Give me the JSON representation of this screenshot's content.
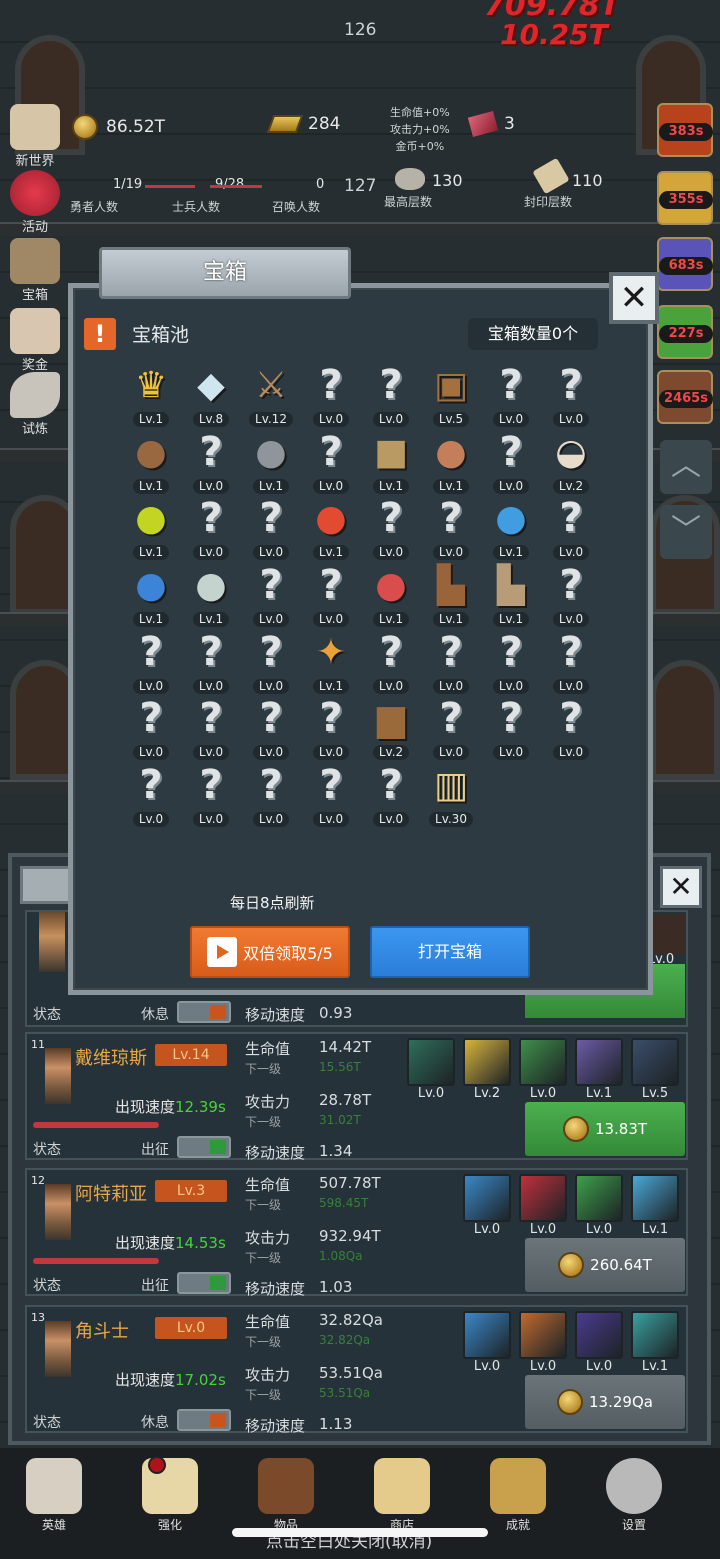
{
  "header": {
    "floor_counter": "126",
    "damage_big": "709.78T",
    "damage_small": "10.25T"
  },
  "resources": {
    "coins": "86.52T",
    "gold_bars": "284",
    "bonus_hp": "生命值+0%",
    "bonus_atk": "攻击力+0%",
    "bonus_gold": "金币+0%",
    "gems": "3"
  },
  "counters": {
    "heroes": "1/19",
    "heroes_label": "勇者人数",
    "soldiers": "9/28",
    "soldiers_label": "士兵人数",
    "summons": "0",
    "summons_label": "召唤人数",
    "current_floor": "127",
    "max_floor": "130",
    "max_floor_label": "最高层数",
    "seal_floor": "110",
    "seal_floor_label": "封印层数"
  },
  "side_menu": [
    {
      "label": "新世界"
    },
    {
      "label": "活动"
    },
    {
      "label": "宝箱"
    },
    {
      "label": "奖金"
    },
    {
      "label": "试炼"
    }
  ],
  "right_timers": [
    "383s",
    "355s",
    "683s",
    "227s",
    "2465s"
  ],
  "dialog": {
    "title": "宝箱",
    "pool_label": "宝箱池",
    "chest_count": "宝箱数量0个",
    "refresh_note": "每日8点刷新",
    "double_button": "双倍领取5/5",
    "open_button": "打开宝箱",
    "items": [
      {
        "icon": "crown-icon",
        "glyph": "♛",
        "color": "#f0c23a",
        "lv": "Lv.1"
      },
      {
        "icon": "diamond-icon",
        "glyph": "◆",
        "color": "#cfe6f0",
        "lv": "Lv.8"
      },
      {
        "icon": "sword-icon",
        "glyph": "⚔",
        "color": "#b98c5c",
        "lv": "Lv.12"
      },
      {
        "icon": "unknown-icon",
        "glyph": "?",
        "color": "",
        "lv": "Lv.0"
      },
      {
        "icon": "unknown-icon",
        "glyph": "?",
        "color": "",
        "lv": "Lv.0"
      },
      {
        "icon": "armor-icon",
        "glyph": "▣",
        "color": "#a4703e",
        "lv": "Lv.5"
      },
      {
        "icon": "unknown-icon",
        "glyph": "?",
        "color": "",
        "lv": "Lv.0"
      },
      {
        "icon": "unknown-icon",
        "glyph": "?",
        "color": "",
        "lv": "Lv.0"
      },
      {
        "icon": "leather-helmet-icon",
        "glyph": "●",
        "color": "#9a6840",
        "lv": "Lv.1"
      },
      {
        "icon": "unknown-icon",
        "glyph": "?",
        "color": "",
        "lv": "Lv.0"
      },
      {
        "icon": "iron-helmet-icon",
        "glyph": "●",
        "color": "#8f959a",
        "lv": "Lv.1"
      },
      {
        "icon": "unknown-icon",
        "glyph": "?",
        "color": "",
        "lv": "Lv.0"
      },
      {
        "icon": "gold-helmet-icon",
        "glyph": "■",
        "color": "#b99a63",
        "lv": "Lv.1"
      },
      {
        "icon": "meat-icon",
        "glyph": "●",
        "color": "#c47f5a",
        "lv": "Lv.1"
      },
      {
        "icon": "unknown-icon",
        "glyph": "?",
        "color": "",
        "lv": "Lv.0"
      },
      {
        "icon": "rice-bowl-icon",
        "glyph": "◒",
        "color": "#e7dccc",
        "lv": "Lv.2"
      },
      {
        "icon": "yellow-potion-icon",
        "glyph": "●",
        "color": "#c4d423",
        "lv": "Lv.1"
      },
      {
        "icon": "unknown-icon",
        "glyph": "?",
        "color": "",
        "lv": "Lv.0"
      },
      {
        "icon": "unknown-icon",
        "glyph": "?",
        "color": "",
        "lv": "Lv.0"
      },
      {
        "icon": "red-potion-icon",
        "glyph": "●",
        "color": "#e14b32",
        "lv": "Lv.1"
      },
      {
        "icon": "unknown-icon",
        "glyph": "?",
        "color": "",
        "lv": "Lv.0"
      },
      {
        "icon": "unknown-icon",
        "glyph": "?",
        "color": "",
        "lv": "Lv.0"
      },
      {
        "icon": "blue-potion-icon",
        "glyph": "●",
        "color": "#3f9de0",
        "lv": "Lv.1"
      },
      {
        "icon": "unknown-icon",
        "glyph": "?",
        "color": "",
        "lv": "Lv.0"
      },
      {
        "icon": "big-blue-potion-icon",
        "glyph": "●",
        "color": "#3b84d8",
        "lv": "Lv.1"
      },
      {
        "icon": "white-bottle-icon",
        "glyph": "●",
        "color": "#c5d3cf",
        "lv": "Lv.1"
      },
      {
        "icon": "unknown-icon",
        "glyph": "?",
        "color": "",
        "lv": "Lv.0"
      },
      {
        "icon": "unknown-icon",
        "glyph": "?",
        "color": "",
        "lv": "Lv.0"
      },
      {
        "icon": "red-bottle-icon",
        "glyph": "●",
        "color": "#d94d4d",
        "lv": "Lv.1"
      },
      {
        "icon": "leather-boots-icon",
        "glyph": "▙",
        "color": "#9a643a",
        "lv": "Lv.1"
      },
      {
        "icon": "cloth-boots-icon",
        "glyph": "▙",
        "color": "#b89c77",
        "lv": "Lv.1"
      },
      {
        "icon": "unknown-icon",
        "glyph": "?",
        "color": "",
        "lv": "Lv.0"
      },
      {
        "icon": "unknown-icon",
        "glyph": "?",
        "color": "",
        "lv": "Lv.0"
      },
      {
        "icon": "unknown-icon",
        "glyph": "?",
        "color": "",
        "lv": "Lv.0"
      },
      {
        "icon": "unknown-icon",
        "glyph": "?",
        "color": "",
        "lv": "Lv.0"
      },
      {
        "icon": "torch-icon",
        "glyph": "✦",
        "color": "#e9a13a",
        "lv": "Lv.1"
      },
      {
        "icon": "unknown-icon",
        "glyph": "?",
        "color": "",
        "lv": "Lv.0"
      },
      {
        "icon": "unknown-icon",
        "glyph": "?",
        "color": "",
        "lv": "Lv.0"
      },
      {
        "icon": "unknown-icon",
        "glyph": "?",
        "color": "",
        "lv": "Lv.0"
      },
      {
        "icon": "unknown-icon",
        "glyph": "?",
        "color": "",
        "lv": "Lv.0"
      },
      {
        "icon": "unknown-icon",
        "glyph": "?",
        "color": "",
        "lv": "Lv.0"
      },
      {
        "icon": "unknown-icon",
        "glyph": "?",
        "color": "",
        "lv": "Lv.0"
      },
      {
        "icon": "unknown-icon",
        "glyph": "?",
        "color": "",
        "lv": "Lv.0"
      },
      {
        "icon": "unknown-icon",
        "glyph": "?",
        "color": "",
        "lv": "Lv.0"
      },
      {
        "icon": "backpack-icon",
        "glyph": "▆",
        "color": "#9b6a3a",
        "lv": "Lv.2"
      },
      {
        "icon": "unknown-icon",
        "glyph": "?",
        "color": "",
        "lv": "Lv.0"
      },
      {
        "icon": "unknown-icon",
        "glyph": "?",
        "color": "",
        "lv": "Lv.0"
      },
      {
        "icon": "unknown-icon",
        "glyph": "?",
        "color": "",
        "lv": "Lv.0"
      },
      {
        "icon": "unknown-icon",
        "glyph": "?",
        "color": "",
        "lv": "Lv.0"
      },
      {
        "icon": "unknown-icon",
        "glyph": "?",
        "color": "",
        "lv": "Lv.0"
      },
      {
        "icon": "unknown-icon",
        "glyph": "?",
        "color": "",
        "lv": "Lv.0"
      },
      {
        "icon": "unknown-icon",
        "glyph": "?",
        "color": "",
        "lv": "Lv.0"
      },
      {
        "icon": "unknown-icon",
        "glyph": "?",
        "color": "",
        "lv": "Lv.0"
      },
      {
        "icon": "beer-mug-icon",
        "glyph": "▥",
        "color": "#e9cf8f",
        "lv": "Lv.30"
      }
    ]
  },
  "hero_list": {
    "partial": {
      "status_label": "状态",
      "status": "休息",
      "speed_label": "移动速度",
      "speed": "0.93",
      "skill_lv": "Lv.0"
    },
    "heroes": [
      {
        "idx": "11",
        "name": "戴维琼斯",
        "level": "Lv.14",
        "appear_label": "出现速度",
        "appear": "12.39s",
        "status_label": "状态",
        "status": "出征",
        "hp_label": "生命值",
        "hp": "14.42T",
        "next_label": "下一级",
        "hp_next": "15.56T",
        "atk_label": "攻击力",
        "atk": "28.78T",
        "atk_next": "31.02T",
        "speed_label": "移动速度",
        "speed": "1.34",
        "skills": [
          "Lv.0",
          "Lv.2",
          "Lv.0",
          "Lv.1",
          "Lv.5"
        ],
        "skill_icons": [
          "skull-shield-icon",
          "blade-icon",
          "boot-icon",
          "claw-icon",
          "bombs-icon"
        ],
        "cost": "13.83T",
        "active": true
      },
      {
        "idx": "12",
        "name": "阿特莉亚",
        "level": "Lv.3",
        "appear_label": "出现速度",
        "appear": "14.53s",
        "status_label": "状态",
        "status": "出征",
        "hp_label": "生命值",
        "hp": "507.78T",
        "next_label": "下一级",
        "hp_next": "598.45T",
        "atk_label": "攻击力",
        "atk": "932.94T",
        "atk_next": "1.08Qa",
        "speed_label": "移动速度",
        "speed": "1.03",
        "skills": [
          "Lv.0",
          "Lv.0",
          "Lv.0",
          "Lv.1"
        ],
        "skill_icons": [
          "red-shield-icon",
          "blood-slash-icon",
          "green-leaf-icon",
          "heart-plus-icon"
        ],
        "cost": "260.64T",
        "active": true
      },
      {
        "idx": "13",
        "name": "角斗士",
        "level": "Lv.0",
        "appear_label": "出现速度",
        "appear": "17.02s",
        "status_label": "状态",
        "status": "休息",
        "hp_label": "生命值",
        "hp": "32.82Qa",
        "next_label": "下一级",
        "hp_next": "32.82Qa",
        "atk_label": "攻击力",
        "atk": "53.51Qa",
        "atk_next": "53.51Qa",
        "speed_label": "移动速度",
        "speed": "1.13",
        "skills": [
          "Lv.0",
          "Lv.0",
          "Lv.0",
          "Lv.1"
        ],
        "skill_icons": [
          "blue-shield-icon",
          "axe-icon",
          "purple-boot-icon",
          "hourglass-icon"
        ],
        "cost": "13.29Qa",
        "active": false
      }
    ]
  },
  "bottom_nav": [
    {
      "label": "英雄",
      "icon": "skull-icon"
    },
    {
      "label": "强化",
      "icon": "candle-icon"
    },
    {
      "label": "物品",
      "icon": "book-icon"
    },
    {
      "label": "商店",
      "icon": "beer-icon"
    },
    {
      "label": "成就",
      "icon": "key-icon"
    },
    {
      "label": "设置",
      "icon": "gear-icon"
    }
  ],
  "bottom_hint": "点击空白处关闭(取消)"
}
